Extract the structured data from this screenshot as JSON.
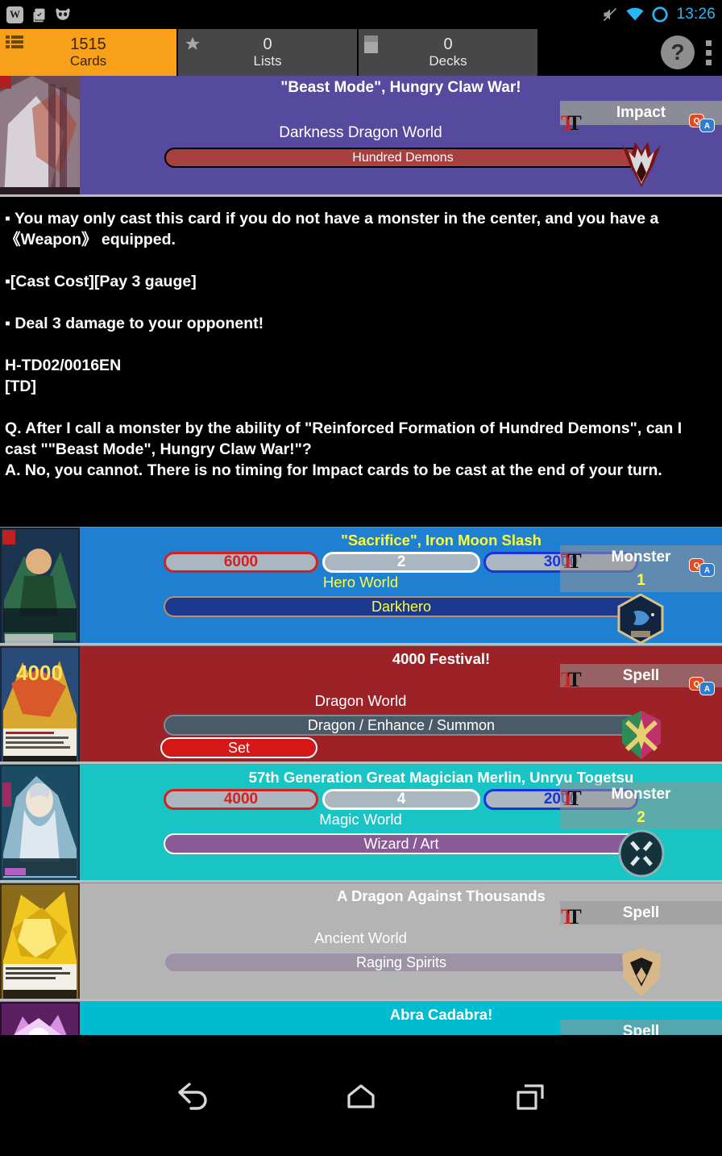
{
  "statusbar": {
    "left_icons": [
      "wikipedia-w-icon",
      "clipboard-check-icon",
      "cyanogenmod-icon"
    ],
    "right_icons": [
      "volume-muted-icon",
      "wifi-icon",
      "ring-indicator-icon"
    ],
    "time": "13:26",
    "time_color": "#29b6f6"
  },
  "tabs": [
    {
      "name": "cards",
      "count": "1515",
      "label": "Cards",
      "icon": "list-icon",
      "active": true,
      "bg": "#f9a01b"
    },
    {
      "name": "lists",
      "count": "0",
      "label": "Lists",
      "icon": "star-icon",
      "active": false,
      "bg": "#474747"
    },
    {
      "name": "decks",
      "count": "0",
      "label": "Decks",
      "icon": "deck-icon",
      "active": false,
      "bg": "#474747"
    }
  ],
  "header_actions": {
    "help_label": "?",
    "help_icon": "question-mark-icon",
    "overflow_icon": "overflow-menu-icon"
  },
  "detail": {
    "title": "\"Beast Mode\", Hungry Claw War!",
    "world": "Darkness Dragon World",
    "attribute": "Hundred Demons",
    "card_type": "Impact",
    "bg_color": "#564a9e",
    "attr_color": "#a8403f",
    "text_icon": "tt-text-size-icon",
    "qa_icon": "qa-bubble-icon",
    "world_icon": "darkness-dragon-world-icon",
    "thumbnail_icon": "card-thumbnail"
  },
  "card_text": {
    "lines": [
      "▪ You may only cast this card if you do not have a monster in the center, and you have a 《Weapon》 equipped.",
      "▪[Cast Cost][Pay 3 gauge]",
      "▪ Deal 3 damage to your opponent!"
    ],
    "card_number": "H-TD02/0016EN",
    "rarity": "[TD]",
    "qa_question": "Q. After I call a monster by the ability of \"Reinforced Formation of Hundred Demons\", can I cast \"\"Beast Mode\", Hungry Claw War!\"?",
    "qa_answer": "A. No, you cannot. There is no timing for Impact cards to be cast at the end of your turn."
  },
  "card_list": [
    {
      "title": "\"Sacrifice\", Iron Moon Slash",
      "world": "Hero World",
      "attribute": "Darkhero",
      "card_type": "Monster",
      "level": "1",
      "power": "6000",
      "size": "2",
      "defense": "3000",
      "set_label": null,
      "bg_color": "#1f7fd0",
      "title_color": "#ffff33",
      "world_color": "#ffff33",
      "attr_bg": "#1b3a8f",
      "attr_border": "#c08a6b",
      "attr_color": "#ffff33",
      "level_color": "#ffff33",
      "world_icon": "hero-world-icon",
      "text_icon": "tt-text-size-icon",
      "qa_icon": "qa-bubble-icon"
    },
    {
      "title": "4000 Festival!",
      "world": "Dragon World",
      "attribute": "Dragon / Enhance / Summon",
      "card_type": "Spell",
      "level": null,
      "power": null,
      "size": null,
      "defense": null,
      "set_label": "Set",
      "bg_color": "#9c2227",
      "title_color": "#ffffff",
      "world_color": "#ffffff",
      "attr_bg": "#4a5a66",
      "attr_border": "#7d8a94",
      "attr_color": "#ffffff",
      "level_color": "#ffffff",
      "world_icon": "dragon-world-icon",
      "text_icon": "tt-text-size-icon",
      "qa_icon": "qa-bubble-icon"
    },
    {
      "title": "57th Generation Great Magician Merlin, Unryu Togetsu",
      "world": "Magic World",
      "attribute": "Wizard / Art",
      "card_type": "Monster",
      "level": "2",
      "power": "4000",
      "size": "4",
      "defense": "2000",
      "set_label": null,
      "bg_color": "#19c4c4",
      "title_color": "#ffffff",
      "world_color": "#ffffff",
      "attr_bg": "#8a5a96",
      "attr_border": "#ffffff",
      "attr_color": "#ffffff",
      "level_color": "#ffff33",
      "world_icon": "magic-world-icon",
      "text_icon": "tt-text-size-icon",
      "qa_icon": "qa-bubble-icon"
    },
    {
      "title": "A Dragon Against Thousands",
      "world": "Ancient World",
      "attribute": "Raging Spirits",
      "card_type": "Spell",
      "level": null,
      "power": null,
      "size": null,
      "defense": null,
      "set_label": null,
      "bg_color": "#b4b4b4",
      "title_color": "#ffffff",
      "world_color": "#ffffff",
      "attr_bg": "#9c93a5",
      "attr_border": "#b9b2c0",
      "attr_color": "#ffffff",
      "level_color": "#ffffff",
      "world_icon": "ancient-world-icon",
      "text_icon": "tt-text-size-icon",
      "qa_icon": null
    },
    {
      "title": "Abra Cadabra!",
      "world": null,
      "attribute": null,
      "card_type": "Spell",
      "level": null,
      "power": null,
      "size": null,
      "defense": null,
      "set_label": null,
      "bg_color": "#00bcd0",
      "title_color": "#ffffff",
      "world_color": "#ffffff",
      "attr_bg": "#8a5a96",
      "attr_border": "#ffffff",
      "attr_color": "#ffffff",
      "level_color": "#ffffff",
      "world_icon": "magic-world-icon",
      "text_icon": "tt-text-size-icon",
      "qa_icon": null
    }
  ],
  "navbar": {
    "back_icon": "back-icon",
    "home_icon": "home-icon",
    "recents_icon": "recents-icon"
  }
}
